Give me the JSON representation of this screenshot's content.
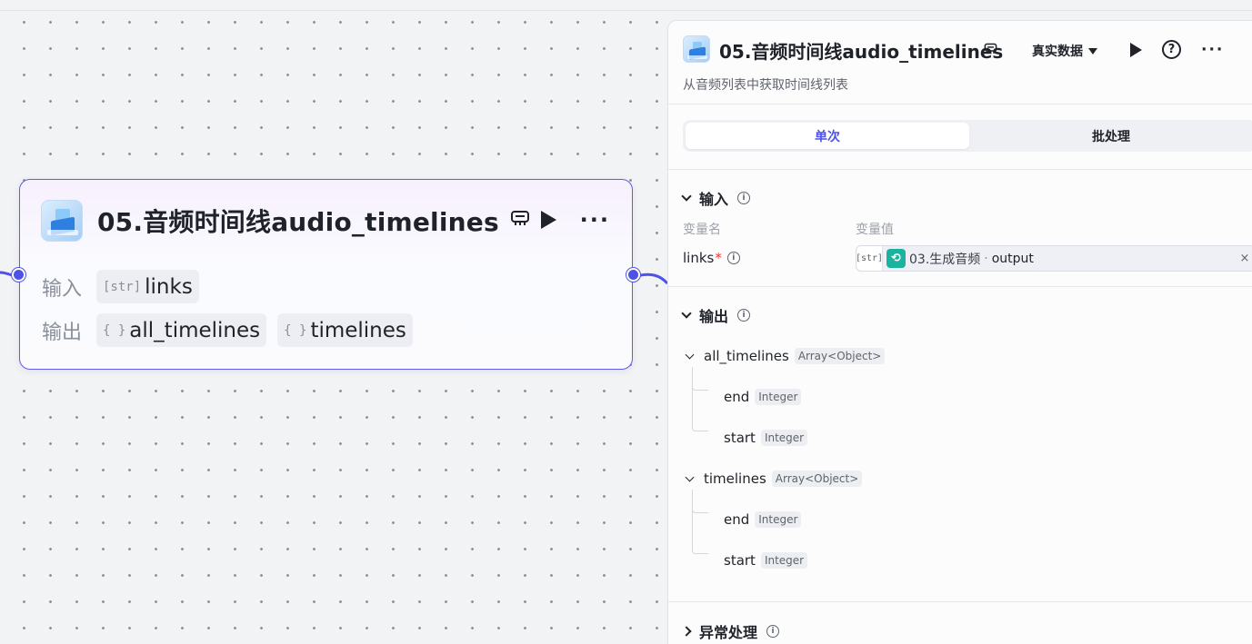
{
  "node": {
    "title": "05.音频时间线audio_timelines",
    "input_label": "输入",
    "output_label": "输出",
    "inputs": [
      {
        "type": "[str]",
        "name": "links"
      }
    ],
    "outputs": [
      {
        "type": "{ }",
        "name": "all_timelines"
      },
      {
        "type": "{ }",
        "name": "timelines"
      }
    ]
  },
  "panel": {
    "title": "05.音频时间线audio_timelines",
    "description": "从音频列表中获取时间线列表",
    "data_mode": "真实数据",
    "tabs": [
      {
        "label": "单次",
        "active": true
      },
      {
        "label": "批处理",
        "active": false
      }
    ],
    "input_section": {
      "title": "输入",
      "col_name": "变量名",
      "col_value": "变量值",
      "var_name": "links",
      "required_mark": "*",
      "ref_type": "[str]",
      "ref_source": "03.生成音频",
      "ref_sep": "·",
      "ref_field": "output",
      "clear": "×"
    },
    "output_section": {
      "title": "输出",
      "items": [
        {
          "name": "all_timelines",
          "type": "Array<Object>",
          "children": [
            {
              "name": "end",
              "type": "Integer"
            },
            {
              "name": "start",
              "type": "Integer"
            }
          ]
        },
        {
          "name": "timelines",
          "type": "Array<Object>",
          "children": [
            {
              "name": "end",
              "type": "Integer"
            },
            {
              "name": "start",
              "type": "Integer"
            }
          ]
        }
      ]
    },
    "exception_section": {
      "title": "异常处理"
    }
  },
  "colors": {
    "accent": "#4d53e8",
    "node_border": "#5b5ee6",
    "ref_icon": "#19b39e"
  }
}
